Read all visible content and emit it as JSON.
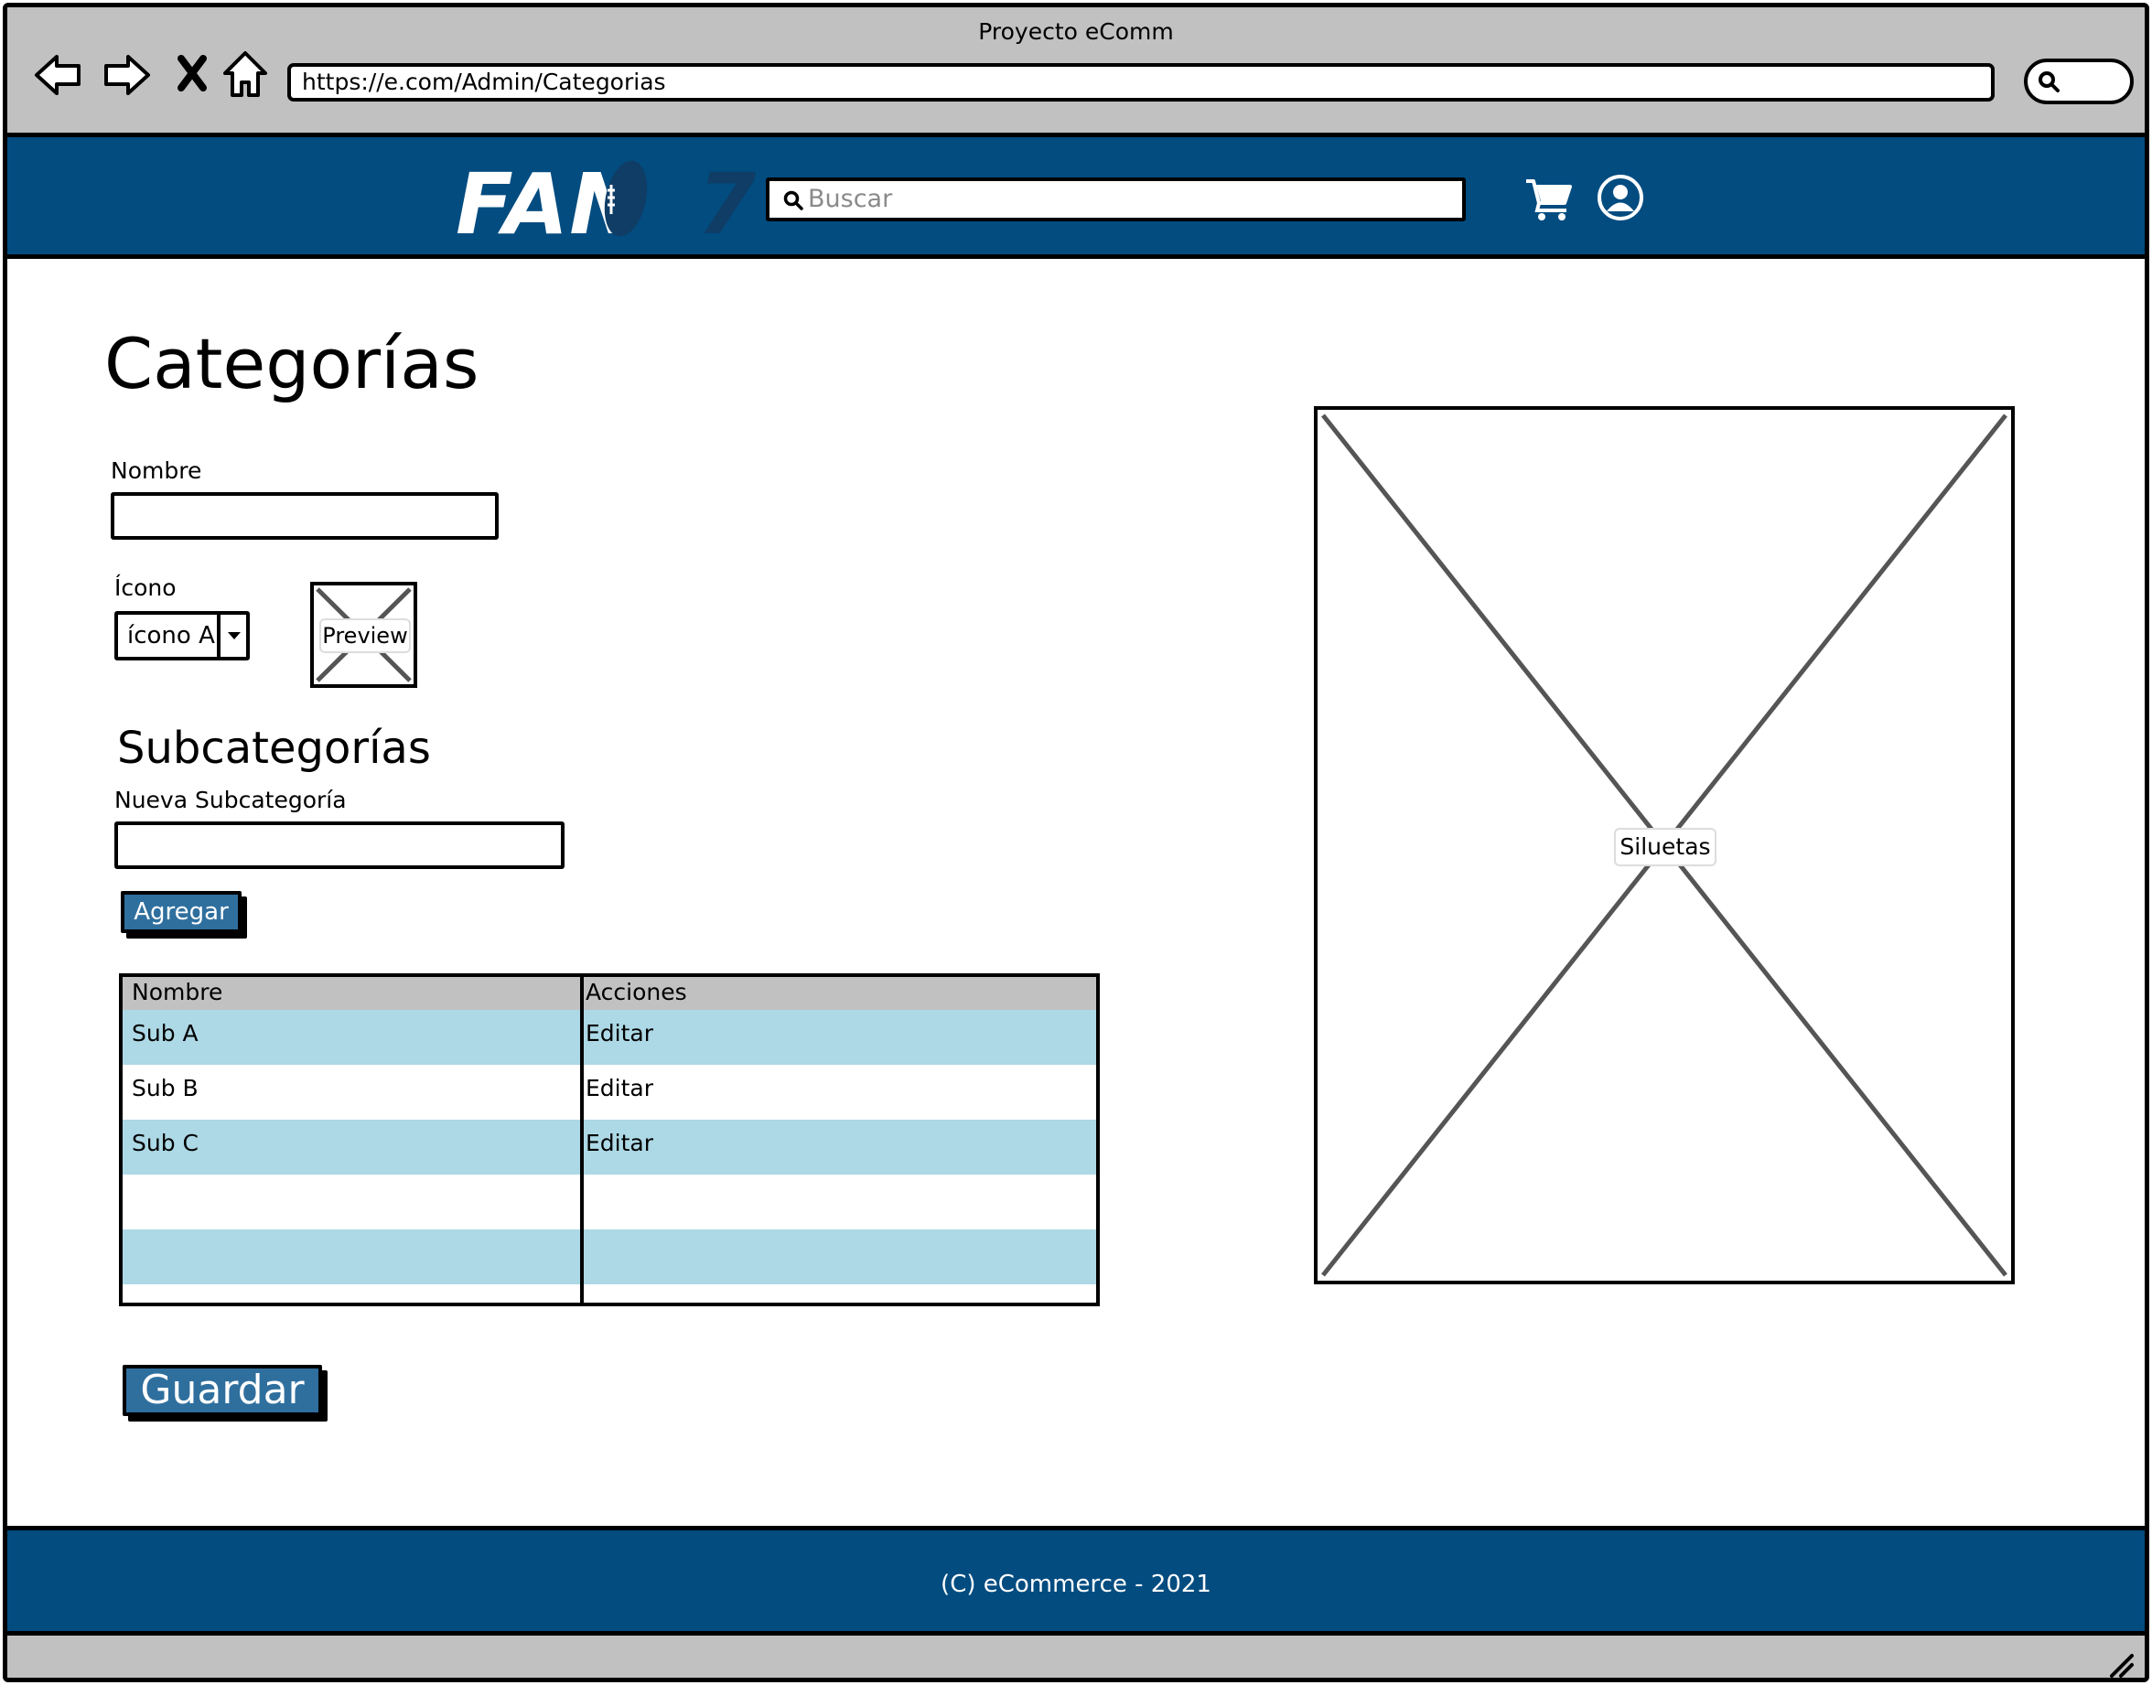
{
  "window": {
    "title": "Proyecto eComm"
  },
  "browser": {
    "url": "https://e.com/Admin/Categorias"
  },
  "header": {
    "logo_text": "FAN",
    "logo_number": "7",
    "search_placeholder": "Buscar"
  },
  "page": {
    "title": "Categorías",
    "nombre_label": "Nombre",
    "nombre_value": "",
    "icono_label": "Ícono",
    "icono_selected": "ícono A",
    "preview_label": "Preview",
    "subcategorias_title": "Subcategorías",
    "nueva_label": "Nueva Subcategoría",
    "nueva_value": "",
    "add_button": "Agregar",
    "save_button": "Guardar",
    "silhouette_label": "Siluetas"
  },
  "table": {
    "headers": [
      "Nombre",
      "Acciones"
    ],
    "rows": [
      {
        "name": "Sub A",
        "action": "Editar"
      },
      {
        "name": "Sub B",
        "action": "Editar"
      },
      {
        "name": "Sub C",
        "action": "Editar"
      },
      {
        "name": "",
        "action": ""
      },
      {
        "name": "",
        "action": ""
      },
      {
        "name": "",
        "action": ""
      }
    ]
  },
  "footer": {
    "text": "(C) eCommerce - 2021"
  },
  "colors": {
    "brand_blue": "#024c80",
    "button_blue": "#2f6f9e",
    "row_highlight": "#add8e6",
    "chrome_gray": "#c1c1c1"
  },
  "icons": [
    "back-icon",
    "forward-icon",
    "stop-icon",
    "home-icon",
    "search-icon",
    "cart-icon",
    "user-icon",
    "chevron-down-icon",
    "resize-icon"
  ]
}
